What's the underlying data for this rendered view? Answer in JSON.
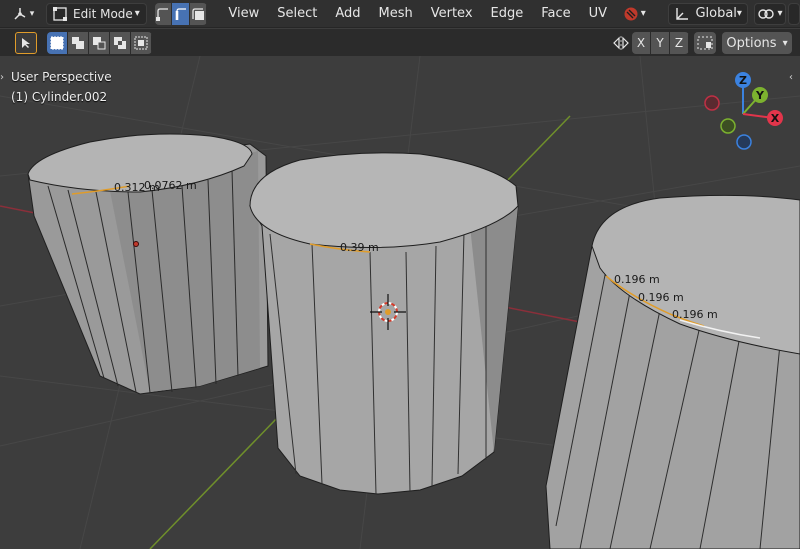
{
  "header": {
    "mode_label": "Edit Mode",
    "menu": [
      "View",
      "Select",
      "Add",
      "Mesh",
      "Vertex",
      "Edge",
      "Face",
      "UV"
    ],
    "orientation_label": "Global"
  },
  "toolbar": {
    "axes": [
      "X",
      "Y",
      "Z"
    ],
    "options_label": "Options"
  },
  "viewport": {
    "perspective_label": "User Perspective",
    "object_label": "(1) Cylinder.002"
  },
  "gizmo": {
    "x_label": "X",
    "y_label": "Y",
    "z_label": "Z"
  },
  "measurements": {
    "m1": "0.312 m",
    "m2": "0.0762 m",
    "m3": "0.39 m",
    "m4": "0.196 m",
    "m5": "0.196 m",
    "m6": "0.196 m"
  },
  "colors": {
    "accent": "#4772b3",
    "x_axis": "#e2354b",
    "y_axis": "#7cb22f",
    "z_axis": "#3b82e0",
    "mesh_face": "#a9a9a9",
    "viewport_bg": "#3d3d3d",
    "selected_edge": "#e09c2a"
  }
}
